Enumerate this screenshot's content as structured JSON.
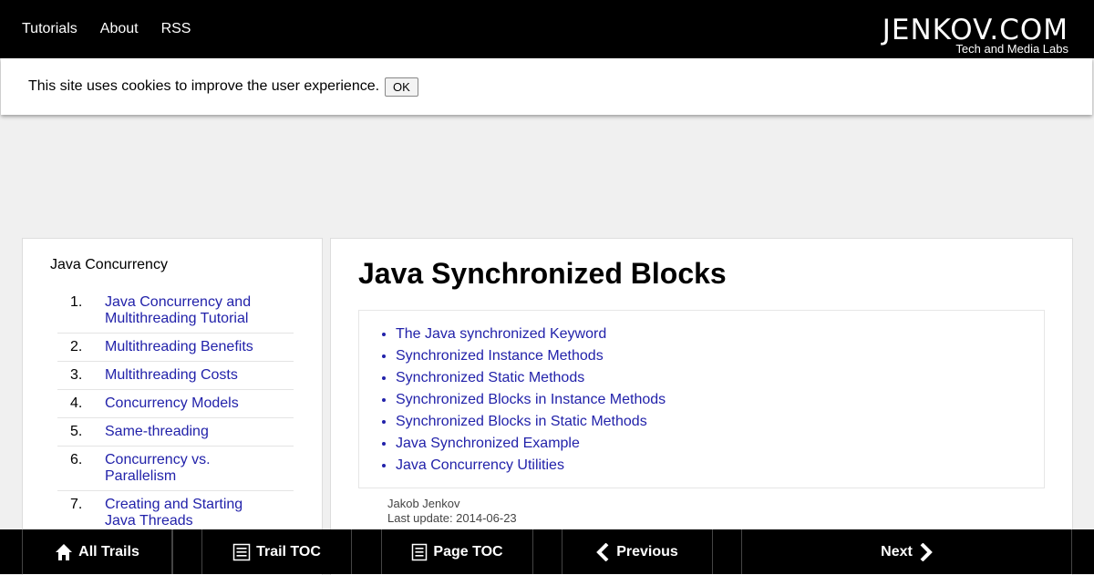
{
  "topnav": {
    "items": [
      "Tutorials",
      "About",
      "RSS"
    ]
  },
  "logo": {
    "text": "JENKOV.COM",
    "subtitle": "Tech and Media Labs"
  },
  "cookie": {
    "text": "This site uses cookies to improve the user experience.",
    "ok_label": "OK"
  },
  "sidebar": {
    "title": "Java Concurrency",
    "items": [
      {
        "num": "1.",
        "label": "Java Concurrency and Multithreading Tutorial"
      },
      {
        "num": "2.",
        "label": "Multithreading Benefits"
      },
      {
        "num": "3.",
        "label": "Multithreading Costs"
      },
      {
        "num": "4.",
        "label": "Concurrency Models"
      },
      {
        "num": "5.",
        "label": "Same-threading"
      },
      {
        "num": "6.",
        "label": "Concurrency vs. Parallelism"
      },
      {
        "num": "7.",
        "label": "Creating and Starting Java Threads"
      }
    ]
  },
  "main": {
    "title": "Java Synchronized Blocks",
    "toc": [
      "The Java synchronized Keyword",
      "Synchronized Instance Methods",
      "Synchronized Static Methods",
      "Synchronized Blocks in Instance Methods",
      "Synchronized Blocks in Static Methods",
      "Java Synchronized Example",
      "Java Concurrency Utilities"
    ],
    "author": "Jakob Jenkov",
    "last_update": "Last update: 2014-06-23"
  },
  "bottombar": {
    "all_trails": "All Trails",
    "trail_toc": "Trail TOC",
    "page_toc": "Page TOC",
    "previous": "Previous",
    "next": "Next"
  },
  "colors": {
    "link": "#2222aa",
    "bar": "#000000"
  },
  "icons": [
    "home-icon",
    "list-icon",
    "page-icon",
    "chevron-left-icon",
    "chevron-right-icon"
  ]
}
